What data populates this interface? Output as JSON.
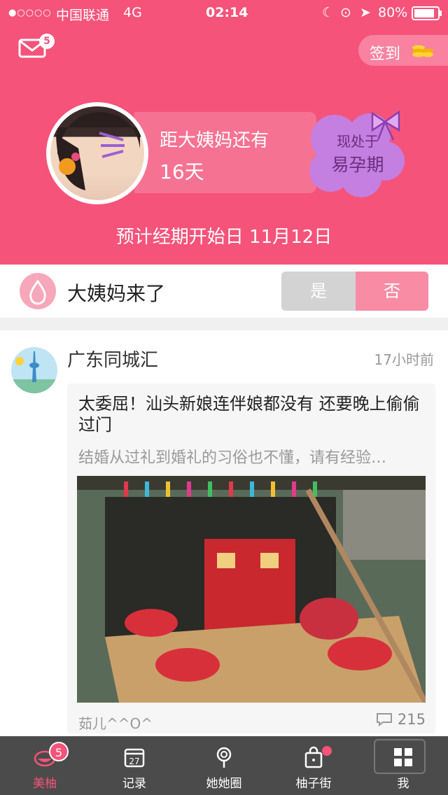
{
  "status_bar": {
    "carrier": "中国联通",
    "network": "4G",
    "time": "02:14",
    "battery": "80%"
  },
  "header": {
    "mail_badge": "5",
    "signin_label": "签到",
    "countdown_label": "距大姨妈还有",
    "countdown_days": "16天",
    "phase_prefix": "现处于",
    "phase_value": "易孕期",
    "predict_text": "预计经期开始日 11月12日",
    "accent_color": "#f5537a"
  },
  "period_row": {
    "label": "大姨妈来了",
    "yes": "是",
    "no": "否"
  },
  "feed": {
    "source": "广东同城汇",
    "time": "17小时前",
    "title": "太委屈！汕头新娘连伴娘都没有 还要晚上偷偷过门",
    "summary": "结婚从过礼到婚礼的习俗也不懂，请有经验…",
    "author": "茹儿^^O^",
    "comment_count": "215"
  },
  "tabbar": {
    "badge": "5",
    "tabs": [
      {
        "label": "美柚",
        "icon": "meiyou-icon"
      },
      {
        "label": "记录",
        "icon": "calendar-icon",
        "calendar_day": "27"
      },
      {
        "label": "她她圈",
        "icon": "lollipop-icon"
      },
      {
        "label": "柚子街",
        "icon": "shopping-bag-icon"
      },
      {
        "label": "我",
        "icon": "grid-icon"
      }
    ]
  }
}
